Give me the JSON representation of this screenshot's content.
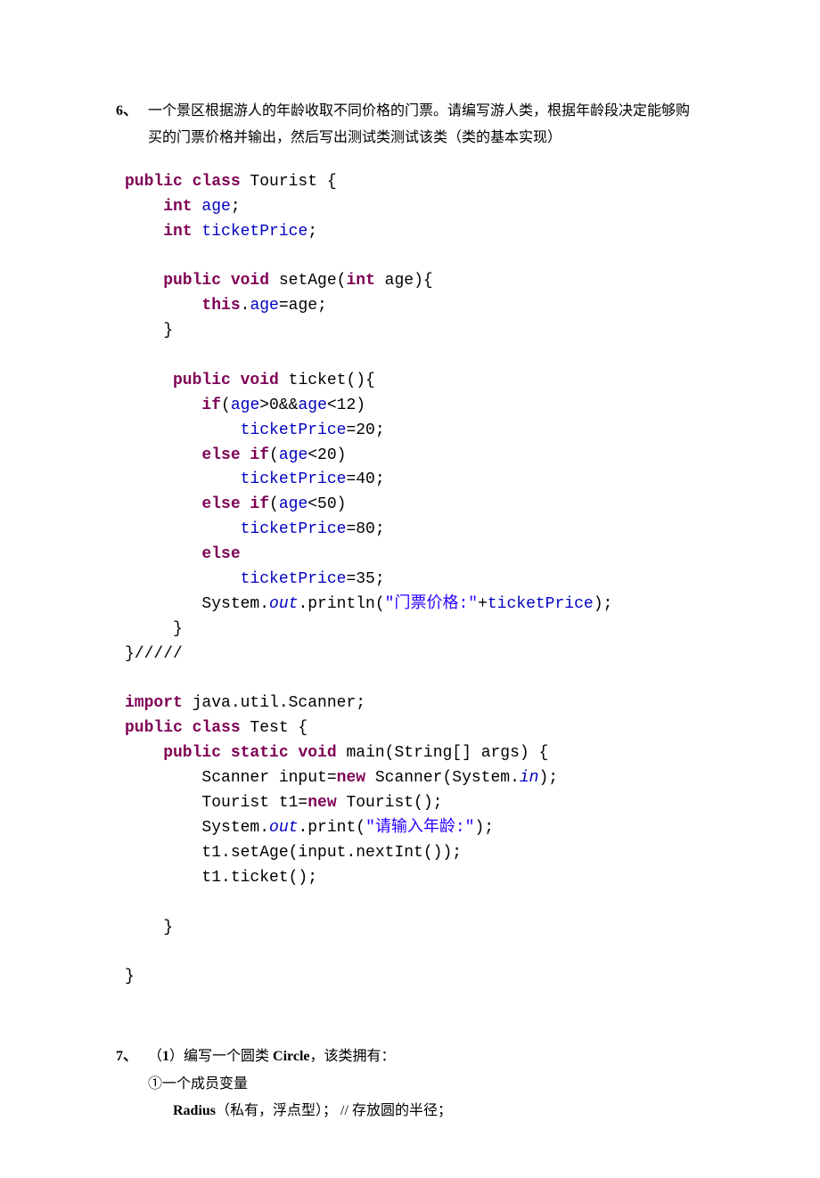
{
  "item6": {
    "num": "6、",
    "line1": "一个景区根据游人的年龄收取不同价格的门票。请编写游人类，根据年龄段决定能够购",
    "line2": "买的门票价格并输出，然后写出测试类测试该类（类的基本实现）"
  },
  "code": {
    "l1a": "public",
    "l1b": " class",
    "l1c": " Tourist {",
    "l2a": "    int",
    "l2b": " age",
    "l2c": ";",
    "l3a": "    int",
    "l3b": " ticketPrice",
    "l3c": ";",
    "l4": "",
    "l5a": "    public",
    "l5b": " void",
    "l5c": " setAge(",
    "l5d": "int",
    "l5e": " age){",
    "l6a": "        this",
    "l6b": ".",
    "l6c": "age",
    "l6d": "=age;",
    "l7": "    }",
    "l8": "",
    "l9a": "     public",
    "l9b": " void",
    "l9c": " ticket(){",
    "l10a": "        if",
    "l10b": "(",
    "l10c": "age",
    "l10d": ">0&&",
    "l10e": "age",
    "l10f": "<12)",
    "l11a": "            ticketPrice",
    "l11b": "=20;",
    "l12a": "        else",
    "l12b": " if",
    "l12c": "(",
    "l12d": "age",
    "l12e": "<20)",
    "l13a": "            ticketPrice",
    "l13b": "=40;",
    "l14a": "        else",
    "l14b": " if",
    "l14c": "(",
    "l14d": "age",
    "l14e": "<50)",
    "l15a": "            ticketPrice",
    "l15b": "=80;",
    "l16a": "        else",
    "l17a": "            ticketPrice",
    "l17b": "=35;",
    "l18a": "        System.",
    "l18b": "out",
    "l18c": ".println(",
    "l18d": "\"门票价格:\"",
    "l18e": "+",
    "l18f": "ticketPrice",
    "l18g": ");",
    "l19": "     }",
    "l20": "}/////",
    "l21": "",
    "l22a": "import",
    "l22b": " java.util.Scanner;",
    "l23a": "public",
    "l23b": " class",
    "l23c": " Test {",
    "l24a": "    public",
    "l24b": " static",
    "l24c": " void",
    "l24d": " main(String[] args) {",
    "l25a": "        Scanner input=",
    "l25b": "new",
    "l25c": " Scanner(System.",
    "l25d": "in",
    "l25e": ");",
    "l26a": "        Tourist t1=",
    "l26b": "new",
    "l26c": " Tourist();",
    "l27a": "        System.",
    "l27b": "out",
    "l27c": ".print(",
    "l27d": "\"请输入年龄:\"",
    "l27e": ");",
    "l28": "        t1.setAge(input.nextInt());",
    "l29": "        t1.ticket();",
    "l30": "",
    "l31": "    }",
    "l32": "",
    "l33": "}"
  },
  "item7": {
    "num": "7、",
    "line1a": "（",
    "line1b": "1",
    "line1c": "）编写一个圆类 ",
    "line1d": "Circle",
    "line1e": "，该类拥有：",
    "line2": "①一个成员变量",
    "line3a": "Radius",
    "line3b": "（私有，浮点型）；",
    "line3c": "    //  存放圆的半径；"
  }
}
